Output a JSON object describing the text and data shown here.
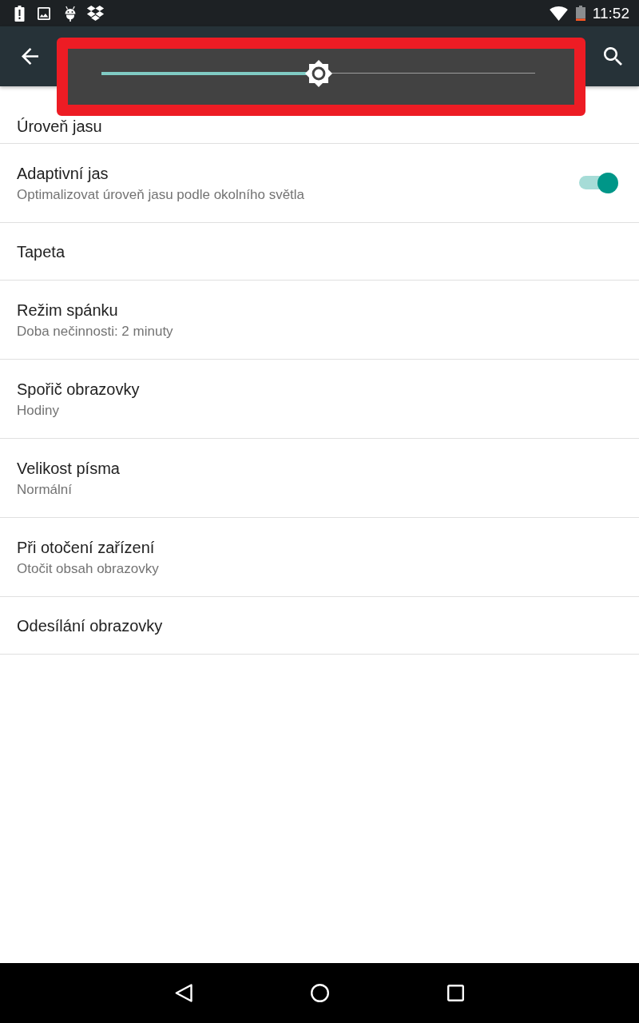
{
  "status_bar": {
    "time": "11:52"
  },
  "brightness_popup": {
    "highlighted": true,
    "level": 0.5
  },
  "settings": [
    {
      "kind": "plain",
      "title": "Úroveň jasu"
    },
    {
      "kind": "switch",
      "title": "Adaptivní jas",
      "subtitle": "Optimalizovat úroveň jasu podle okolního světla",
      "on": true
    },
    {
      "kind": "plain",
      "title": "Tapeta"
    },
    {
      "kind": "plain",
      "title": "Režim spánku",
      "subtitle": "Doba nečinnosti: 2 minuty"
    },
    {
      "kind": "plain",
      "title": "Spořič obrazovky",
      "subtitle": "Hodiny"
    },
    {
      "kind": "plain",
      "title": "Velikost písma",
      "subtitle": "Normální"
    },
    {
      "kind": "plain",
      "title": "Při otočení zařízení",
      "subtitle": "Otočit obsah obrazovky"
    },
    {
      "kind": "plain",
      "title": "Odesílání obrazovky"
    }
  ]
}
